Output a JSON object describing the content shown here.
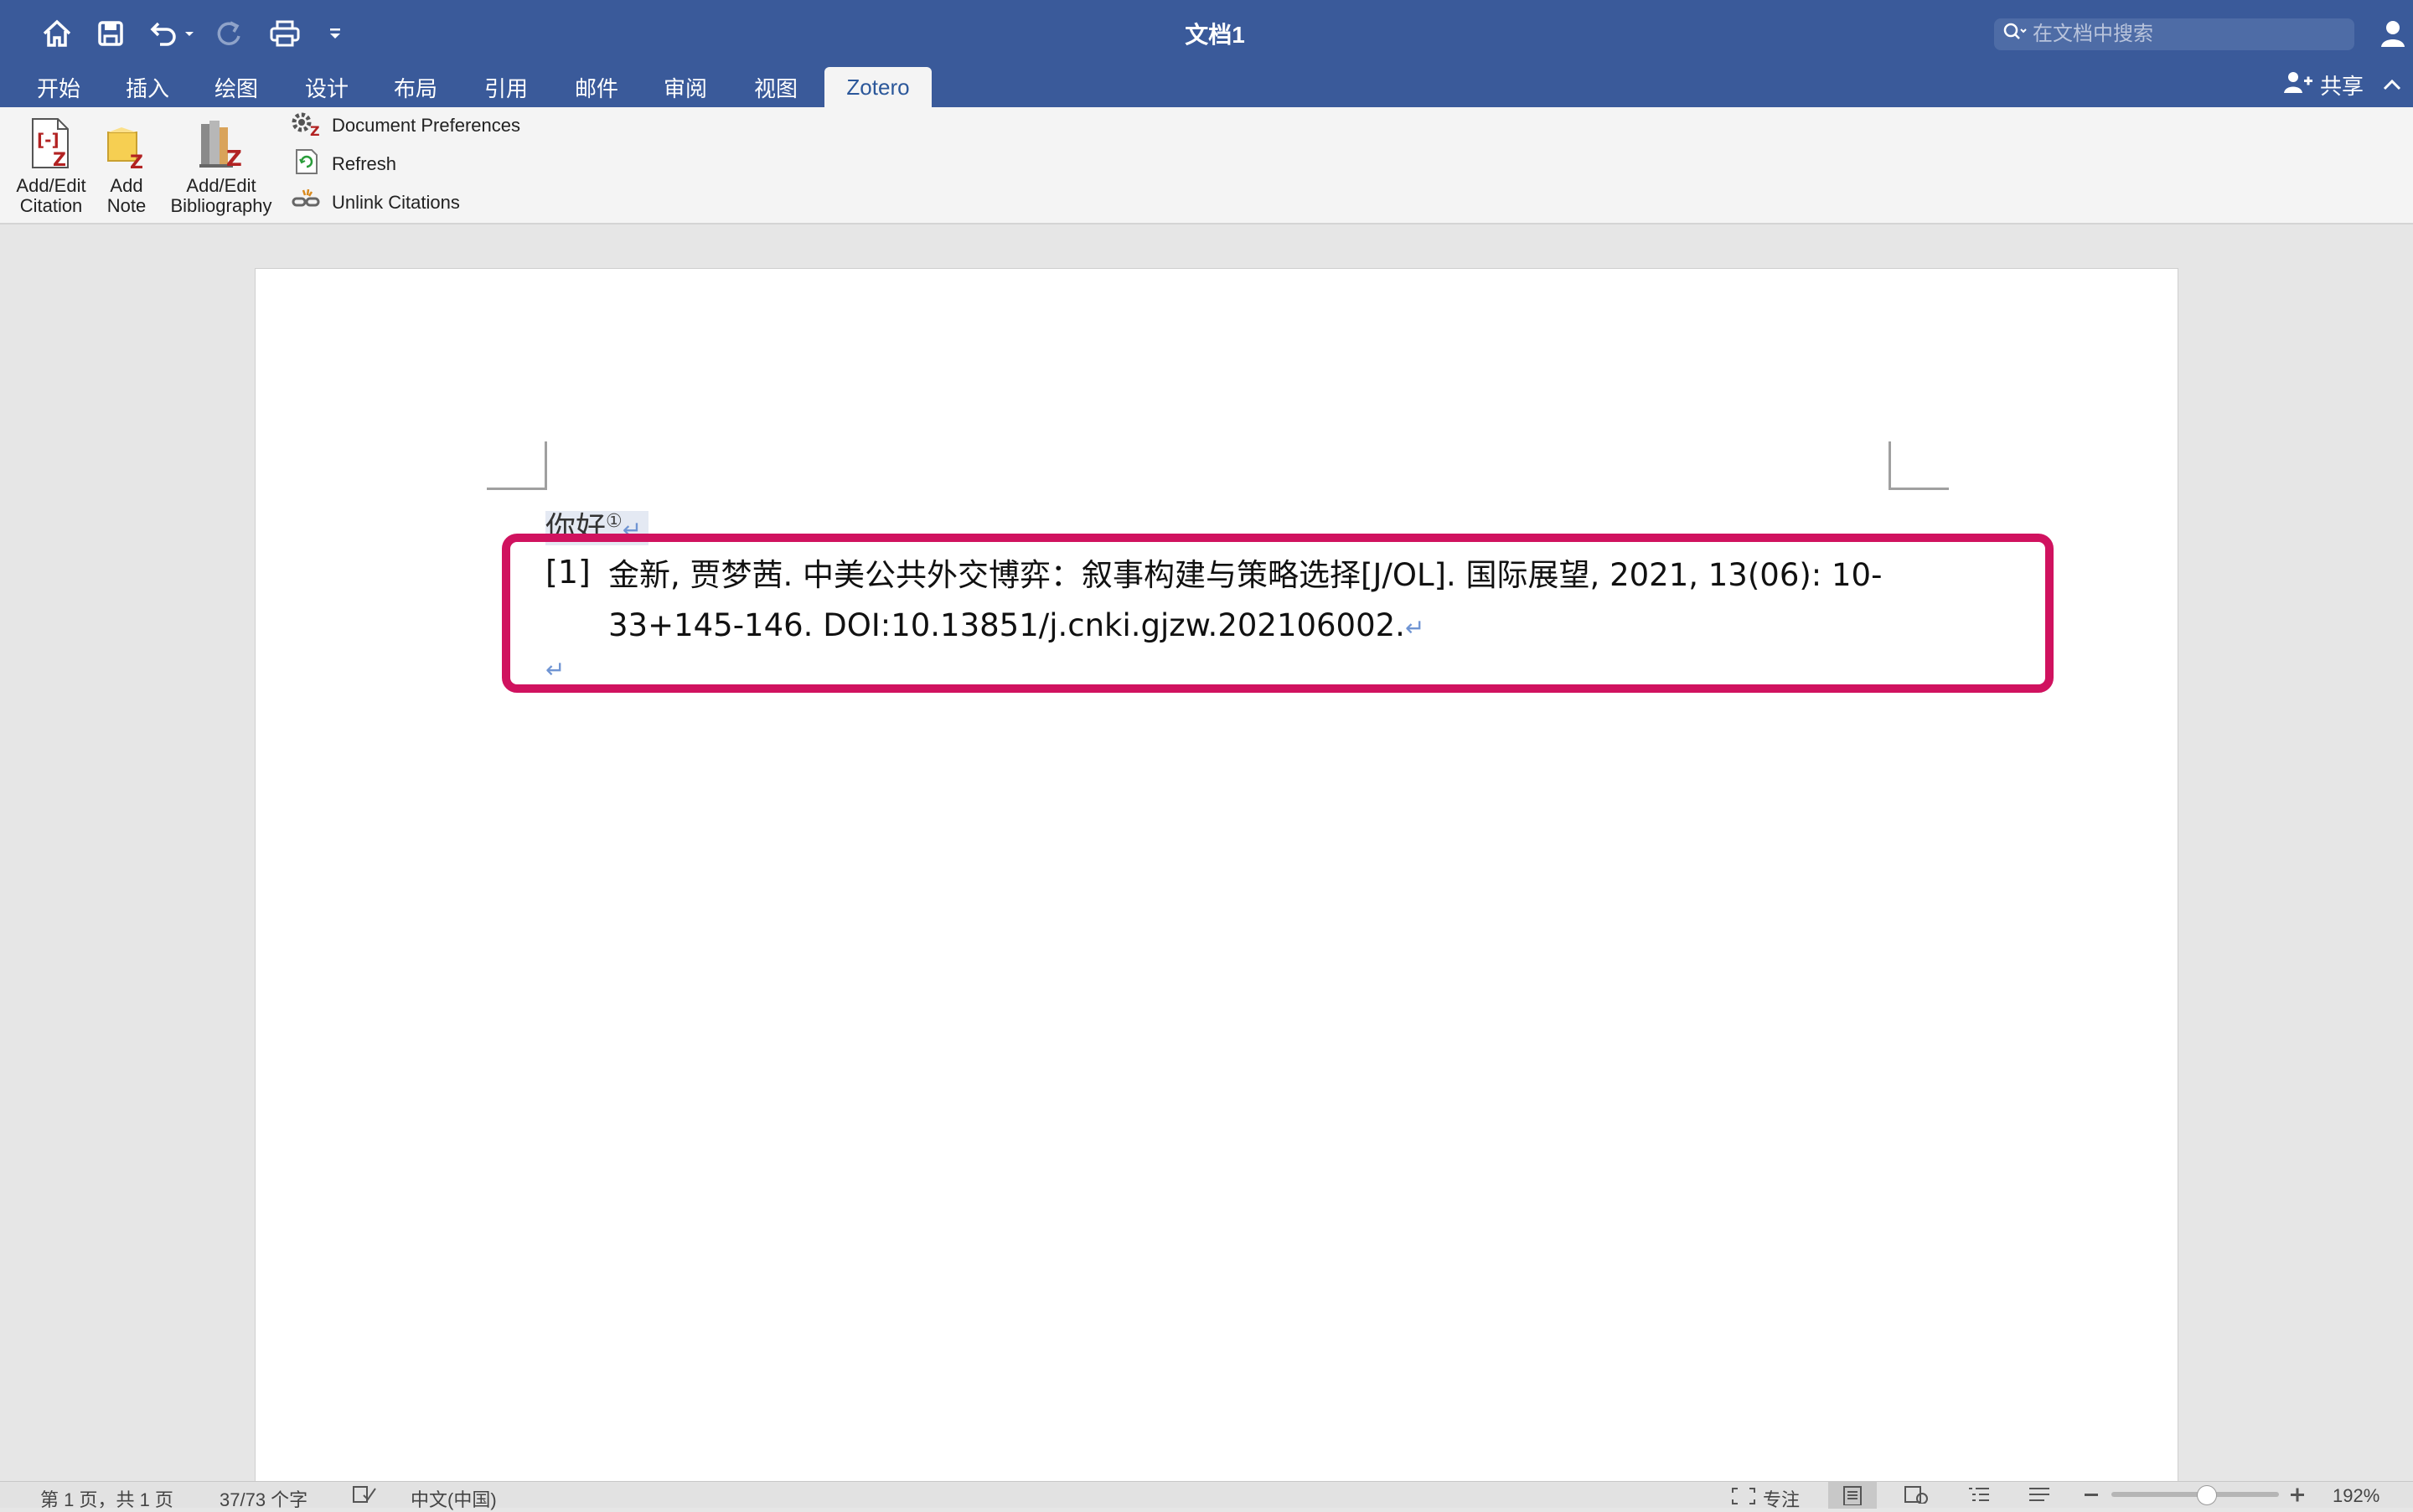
{
  "window": {
    "title": "文档1"
  },
  "search": {
    "placeholder": "在文档中搜索"
  },
  "tabs": [
    {
      "label": "开始"
    },
    {
      "label": "插入"
    },
    {
      "label": "绘图"
    },
    {
      "label": "设计"
    },
    {
      "label": "布局"
    },
    {
      "label": "引用"
    },
    {
      "label": "邮件"
    },
    {
      "label": "审阅"
    },
    {
      "label": "视图"
    },
    {
      "label": "Zotero",
      "active": true
    }
  ],
  "share_label": "共享",
  "ribbon": {
    "add_edit_citation": {
      "line1": "Add/Edit",
      "line2": "Citation"
    },
    "add_note": {
      "line1": "Add",
      "line2": "Note"
    },
    "add_edit_bibliography": {
      "line1": "Add/Edit",
      "line2": "Bibliography"
    },
    "document_preferences": "Document Preferences",
    "refresh": "Refresh",
    "unlink_citations": "Unlink Citations"
  },
  "document": {
    "paragraph1": "你好",
    "citation_marker": "①",
    "bibliography": {
      "number": "[1]",
      "text": "金新, 贾梦茜. 中美公共外交博弈：叙事构建与策略选择[J/OL]. 国际展望, 2021, 13(06): 10-33+145-146. DOI:10.13851/j.cnki.gjzw.202106002."
    },
    "paragraph_mark": "↵"
  },
  "statusbar": {
    "page_info": "第 1 页，共 1 页",
    "word_count": "37/73 个字",
    "language": "中文(中国)",
    "focus": "专注",
    "zoom": "192%"
  },
  "colors": {
    "titlebar": "#3a5a9a",
    "ribbon": "#f4f4f4",
    "highlight_box": "#d0125f"
  }
}
